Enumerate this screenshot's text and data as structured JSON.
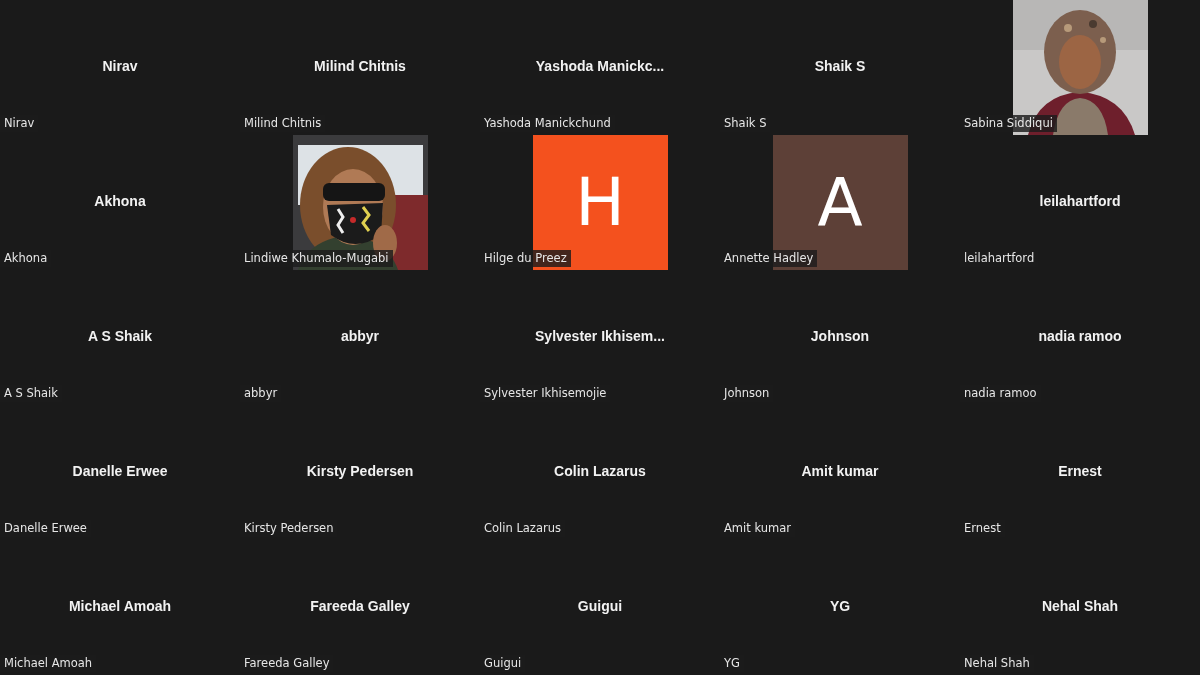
{
  "tiles": [
    {
      "kind": "name",
      "name": "Nirav",
      "label": "Nirav"
    },
    {
      "kind": "name",
      "name": "Milind Chitnis",
      "label": "Milind Chitnis"
    },
    {
      "kind": "name",
      "name": "Yashoda  Manickc...",
      "label": "Yashoda Manickchund"
    },
    {
      "kind": "name",
      "name": "Shaik S",
      "label": "Shaik S"
    },
    {
      "label": "Sabina Siddiqui"
    },
    {
      "kind": "name",
      "name": "Akhona",
      "label": "Akhona"
    },
    {
      "label": "Lindiwe Khumalo-Mugabi"
    },
    {
      "kind": "initial",
      "initial": "H",
      "color": "#f4511e",
      "label": "Hilge du Preez"
    },
    {
      "kind": "initial",
      "initial": "A",
      "color": "#5d4037",
      "label": "Annette Hadley"
    },
    {
      "kind": "name",
      "name": "leilahartford",
      "label": "leilahartford"
    },
    {
      "kind": "name",
      "name": "A S Shaik",
      "label": "A S Shaik"
    },
    {
      "kind": "name",
      "name": "abbyr",
      "label": "abbyr"
    },
    {
      "kind": "name",
      "name": "Sylvester  Ikhisem...",
      "label": "Sylvester Ikhisemojie"
    },
    {
      "kind": "name",
      "name": "Johnson",
      "label": "Johnson"
    },
    {
      "kind": "name",
      "name": "nadia ramoo",
      "label": "nadia ramoo"
    },
    {
      "kind": "name",
      "name": "Danelle Erwee",
      "label": "Danelle Erwee"
    },
    {
      "kind": "name",
      "name": "Kirsty Pedersen",
      "label": "Kirsty Pedersen"
    },
    {
      "kind": "name",
      "name": "Colin Lazarus",
      "label": "Colin Lazarus"
    },
    {
      "kind": "name",
      "name": "Amit kumar",
      "label": "Amit kumar"
    },
    {
      "kind": "name",
      "name": "Ernest",
      "label": "Ernest"
    },
    {
      "kind": "name",
      "name": "Michael Amoah",
      "label": "Michael Amoah"
    },
    {
      "kind": "name",
      "name": "Fareeda Galley",
      "label": "Fareeda Galley"
    },
    {
      "kind": "name",
      "name": "Guigui",
      "label": "Guigui"
    },
    {
      "kind": "name",
      "name": "YG",
      "label": "YG"
    },
    {
      "kind": "name",
      "name": "Nehal Shah",
      "label": "Nehal Shah"
    }
  ]
}
